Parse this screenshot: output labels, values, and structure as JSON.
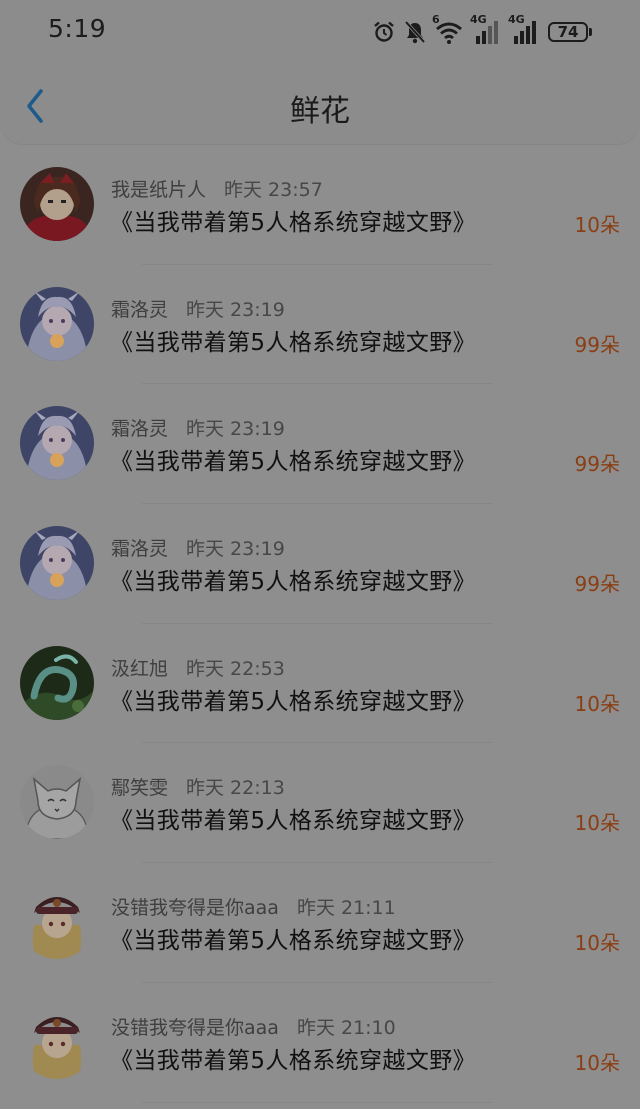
{
  "status_bar": {
    "time": "5:19",
    "net_label_1": "6",
    "net_label_2": "4G",
    "net_label_3": "4G",
    "battery": "74"
  },
  "header": {
    "title": "鲜花"
  },
  "colors": {
    "count_color": "#8a3e14",
    "back_arrow": "#1f5b8a"
  },
  "records": [
    {
      "user": "我是纸片人",
      "time": "昨天 23:57",
      "book": "《当我带着第5人格系统穿越文野》",
      "count": "10朵"
    },
    {
      "user": "霜洛灵",
      "time": "昨天 23:19",
      "book": "《当我带着第5人格系统穿越文野》",
      "count": "99朵"
    },
    {
      "user": "霜洛灵",
      "time": "昨天 23:19",
      "book": "《当我带着第5人格系统穿越文野》",
      "count": "99朵"
    },
    {
      "user": "霜洛灵",
      "time": "昨天 23:19",
      "book": "《当我带着第5人格系统穿越文野》",
      "count": "99朵"
    },
    {
      "user": "汲红旭",
      "time": "昨天 22:53",
      "book": "《当我带着第5人格系统穿越文野》",
      "count": "10朵"
    },
    {
      "user": "鄢笑雯",
      "time": "昨天 22:13",
      "book": "《当我带着第5人格系统穿越文野》",
      "count": "10朵"
    },
    {
      "user": "没错我夸得是你aaa",
      "time": "昨天 21:11",
      "book": "《当我带着第5人格系统穿越文野》",
      "count": "10朵"
    },
    {
      "user": "没错我夸得是你aaa",
      "time": "昨天 21:10",
      "book": "《当我带着第5人格系统穿越文野》",
      "count": "10朵"
    }
  ]
}
